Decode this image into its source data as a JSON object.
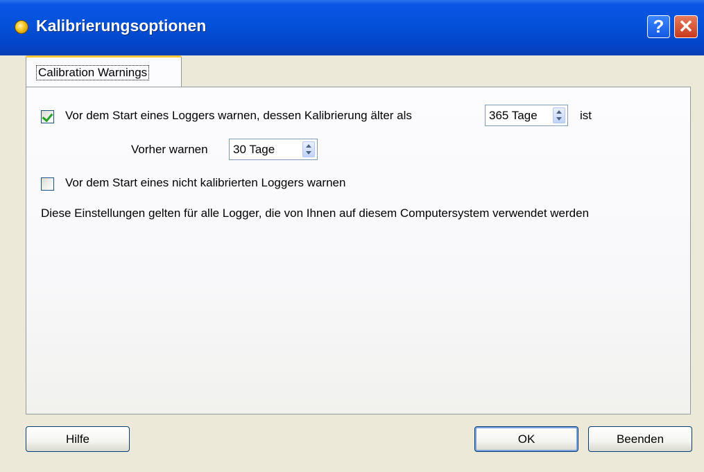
{
  "window": {
    "title": "Kalibrierungsoptionen",
    "help_button": "?",
    "close_button": "✕"
  },
  "tabs": [
    {
      "label": "Calibration Warnings",
      "selected": true
    }
  ],
  "settings": {
    "warn_old_calibration": {
      "checked": true,
      "label": "Vor dem Start eines Loggers warnen, dessen Kalibrierung älter als",
      "value": "365 Tage",
      "suffix": "ist"
    },
    "warn_before": {
      "label": "Vorher warnen",
      "value": "30 Tage"
    },
    "warn_uncalibrated": {
      "checked": false,
      "label": "Vor dem Start eines nicht kalibrierten Loggers warnen"
    },
    "note": "Diese Einstellungen gelten für alle Logger, die von Ihnen auf diesem Computersystem verwendet werden"
  },
  "buttons": {
    "help": "Hilfe",
    "ok": "OK",
    "cancel": "Beenden"
  },
  "colors": {
    "titlebar": "#0453dc",
    "check_green": "#21a121",
    "tab_highlight": "#ffc83c"
  }
}
